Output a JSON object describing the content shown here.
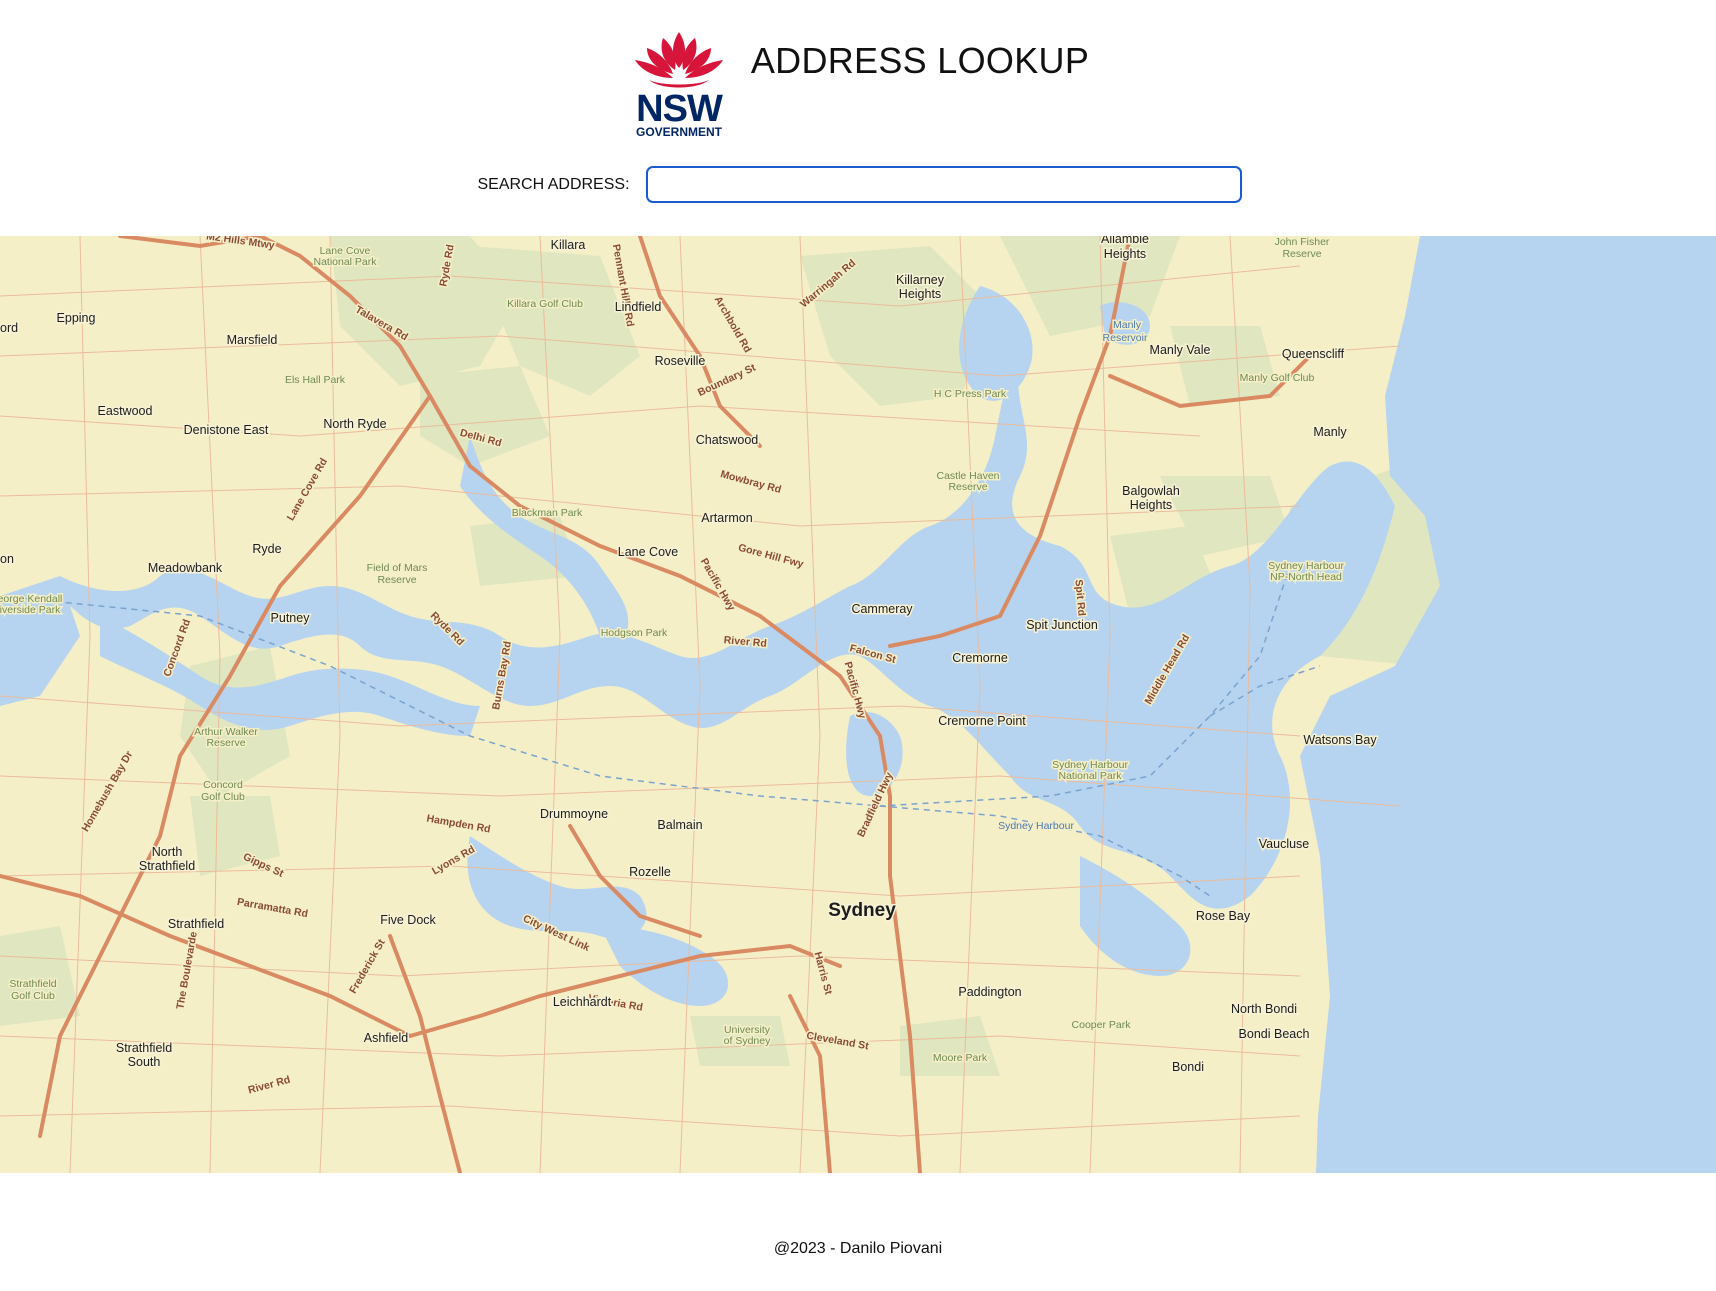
{
  "header": {
    "title": "ADDRESS LOOKUP",
    "logo": {
      "wordmark": "NSW",
      "sub": "GOVERNMENT",
      "brand_red": "#d7153a",
      "brand_navy": "#002664"
    }
  },
  "search": {
    "label": "SEARCH ADDRESS:",
    "value": "",
    "placeholder": ""
  },
  "map": {
    "colors": {
      "land": "#f5efc8",
      "water": "#b6d4ef",
      "park": "#dfe6c0",
      "major_road": "#d98a62",
      "minor_road": "#ecbb9b"
    },
    "suburbs": [
      {
        "name": "Killara"
      },
      {
        "name": "Allambie"
      },
      {
        "name": "Heights"
      },
      {
        "name": "Killarney"
      },
      {
        "name": "Heights"
      },
      {
        "name": "Epping"
      },
      {
        "name": "Marsfield"
      },
      {
        "name": "Lindfield"
      },
      {
        "name": "Roseville"
      },
      {
        "name": "Manly Vale"
      },
      {
        "name": "Queenscliff"
      },
      {
        "name": "Manly"
      },
      {
        "name": "Eastwood"
      },
      {
        "name": "Denistone East"
      },
      {
        "name": "North Ryde"
      },
      {
        "name": "Chatswood"
      },
      {
        "name": "Balgowlah"
      },
      {
        "name": "Heights"
      },
      {
        "name": "Artarmon"
      },
      {
        "name": "Lane Cove"
      },
      {
        "name": "Ryde"
      },
      {
        "name": "Meadowbank"
      },
      {
        "name": "Putney"
      },
      {
        "name": "Cammeray"
      },
      {
        "name": "Spit Junction"
      },
      {
        "name": "Cremorne"
      },
      {
        "name": "Cremorne Point"
      },
      {
        "name": "Watsons Bay"
      },
      {
        "name": "Drummoyne"
      },
      {
        "name": "Balmain"
      },
      {
        "name": "Vaucluse"
      },
      {
        "name": "North"
      },
      {
        "name": "Strathfield"
      },
      {
        "name": "Rozelle"
      },
      {
        "name": "Sydney"
      },
      {
        "name": "Rose Bay"
      },
      {
        "name": "Five Dock"
      },
      {
        "name": "Strathfield"
      },
      {
        "name": "Leichhardt"
      },
      {
        "name": "Paddington"
      },
      {
        "name": "North Bondi"
      },
      {
        "name": "Bondi Beach"
      },
      {
        "name": "Strathfield"
      },
      {
        "name": "South"
      },
      {
        "name": "Ashfield"
      },
      {
        "name": "Bondi"
      },
      {
        "name": "ord"
      },
      {
        "name": "on"
      }
    ],
    "parks": [
      {
        "name": "Lane Cove"
      },
      {
        "name": "National Park"
      },
      {
        "name": "Killara Golf Club"
      },
      {
        "name": "Els Hall Park"
      },
      {
        "name": "John Fisher"
      },
      {
        "name": "Reserve"
      },
      {
        "name": "Manly"
      },
      {
        "name": "Reservoir"
      },
      {
        "name": "Manly Golf Club"
      },
      {
        "name": "H C Press Park"
      },
      {
        "name": "Castle Haven"
      },
      {
        "name": "Reserve"
      },
      {
        "name": "Blackman Park"
      },
      {
        "name": "Field of Mars"
      },
      {
        "name": "Reserve"
      },
      {
        "name": "Sydney Harbour"
      },
      {
        "name": "NP-North Head"
      },
      {
        "name": "eorge Kendall"
      },
      {
        "name": "iverside Park"
      },
      {
        "name": "Hodgson Park"
      },
      {
        "name": "Arthur Walker"
      },
      {
        "name": "Reserve"
      },
      {
        "name": "Sydney Harbour"
      },
      {
        "name": "National Park"
      },
      {
        "name": "Concord"
      },
      {
        "name": "Golf Club"
      },
      {
        "name": "Sydney Harbour"
      },
      {
        "name": "University"
      },
      {
        "name": "of Sydney"
      },
      {
        "name": "Moore Park"
      },
      {
        "name": "Cooper Park"
      },
      {
        "name": "Strathfield"
      },
      {
        "name": "Golf Club"
      }
    ],
    "roads": [
      {
        "name": "M2 Hills Mtwy"
      },
      {
        "name": "Ryde Rd"
      },
      {
        "name": "Archbold Rd"
      },
      {
        "name": "Warringah Rd"
      },
      {
        "name": "Talavera Rd"
      },
      {
        "name": "Boundary St"
      },
      {
        "name": "Pennant Hills Rd"
      },
      {
        "name": "Delhi Rd"
      },
      {
        "name": "Lane Cove Rd"
      },
      {
        "name": "Mowbray Rd"
      },
      {
        "name": "Gore Hill Fwy"
      },
      {
        "name": "Pacific Hwy"
      },
      {
        "name": "Spit Rd"
      },
      {
        "name": "Concord Rd"
      },
      {
        "name": "Ryde Rd"
      },
      {
        "name": "River Rd"
      },
      {
        "name": "Falcon St"
      },
      {
        "name": "Burns Bay Rd"
      },
      {
        "name": "Pacific Hwy"
      },
      {
        "name": "Middle Head Rd"
      },
      {
        "name": "Homebush Bay Dr"
      },
      {
        "name": "Bradfield Hwy"
      },
      {
        "name": "Lyons Rd"
      },
      {
        "name": "Gipps St"
      },
      {
        "name": "Parramatta Rd"
      },
      {
        "name": "City West Link"
      },
      {
        "name": "Harris St"
      },
      {
        "name": "Frederick St"
      },
      {
        "name": "Cleveland St"
      },
      {
        "name": "The Boulevarde"
      },
      {
        "name": "River Rd"
      },
      {
        "name": "Hampden Rd"
      },
      {
        "name": "Victoria Rd"
      }
    ],
    "zoom": {
      "in_label": "+",
      "out_label": "−"
    }
  },
  "footer": {
    "text": "@2023 - Danilo Piovani"
  }
}
